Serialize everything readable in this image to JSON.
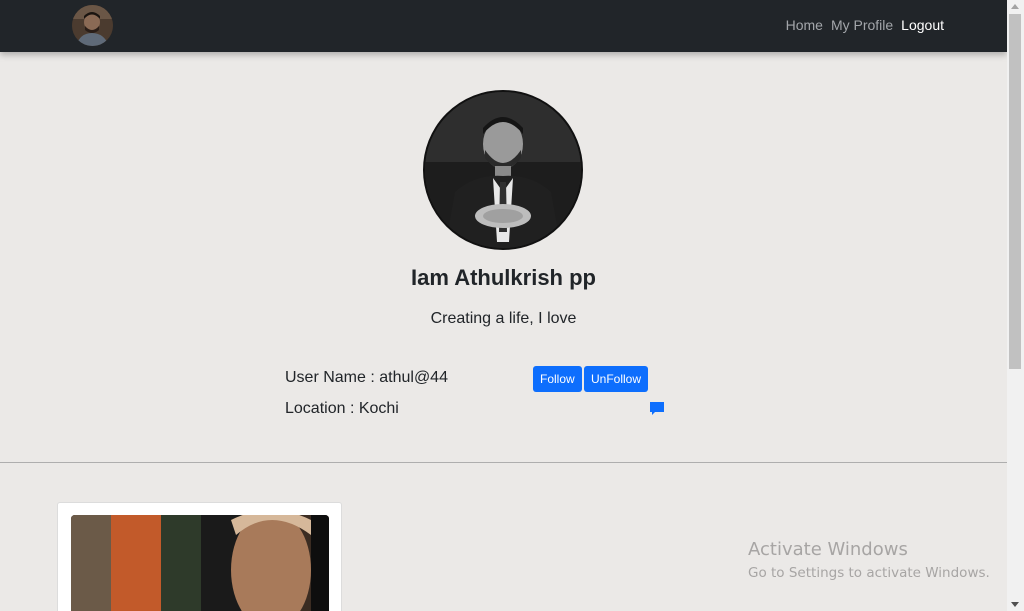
{
  "navbar": {
    "avatar_icon": "user-avatar",
    "links": [
      {
        "label": "Home"
      },
      {
        "label": "My Profile"
      },
      {
        "label": "Logout"
      }
    ]
  },
  "profile": {
    "name": "Iam Athulkrish pp",
    "bio": "Creating a life, I love",
    "username_line": "User Name : athul@44",
    "location_line": "Location : Kochi",
    "follow_label": "Follow",
    "unfollow_label": "UnFollow",
    "message_icon": "chat-bubble-icon"
  },
  "windows_watermark": {
    "title": "Activate Windows",
    "subtitle": "Go to Settings to activate Windows."
  },
  "colors": {
    "navbar_bg": "#212529",
    "page_bg": "#ebe9e7",
    "primary": "#0d6efd"
  }
}
